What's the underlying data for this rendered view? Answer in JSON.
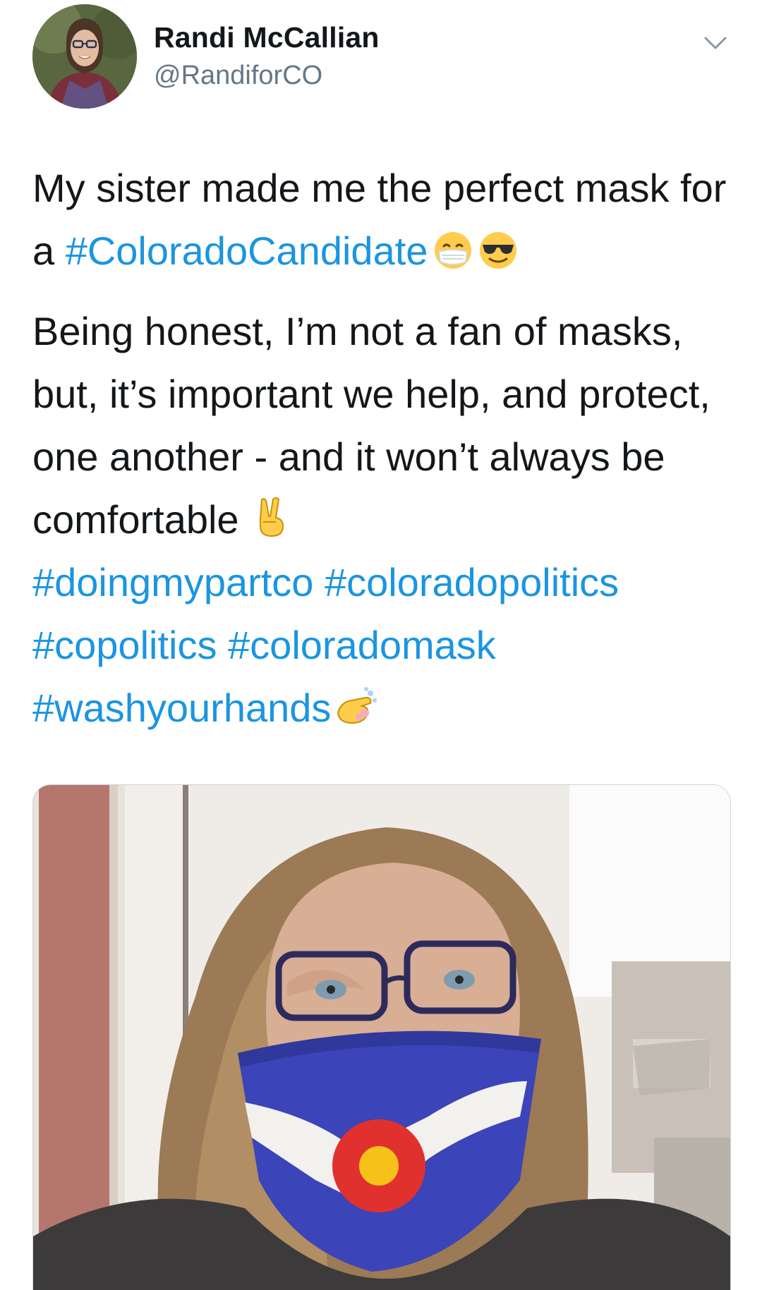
{
  "tweet": {
    "author": {
      "name": "Randi McCallian",
      "handle": "@RandiforCO"
    },
    "text": {
      "line1_a": "My sister made me the perfect mask for a ",
      "hashtag_colorado_candidate": "#ColoradoCandidate",
      "line2": "Being honest, I’m not a fan of masks, but, it’s important we help, and protect, one another - and it won’t always be comfortable",
      "hashtag_doingmypartco": "#doingmypartco",
      "hashtag_coloradopolitics": "#coloradopolitics",
      "hashtag_copolitics": "#copolitics",
      "hashtag_coloradomask": "#coloradomask",
      "hashtag_washyourhands": "#washyourhands"
    },
    "emojis": [
      "mask-face-emoji",
      "sunglasses-face-emoji",
      "victory-hand-emoji",
      "washing-hands-emoji"
    ],
    "colors": {
      "link": "#1b95e0",
      "text": "#14171a",
      "secondary": "#657786"
    }
  }
}
